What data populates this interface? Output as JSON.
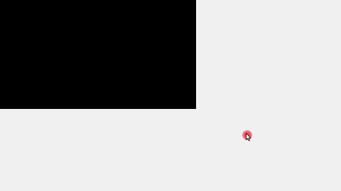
{
  "screen": {
    "background_color": "#f0f0f0"
  },
  "video_panel": {
    "color": "#000000"
  },
  "pointer": {
    "icon": "mouse-cursor-icon",
    "click_indicator_color": "#e8364a"
  }
}
